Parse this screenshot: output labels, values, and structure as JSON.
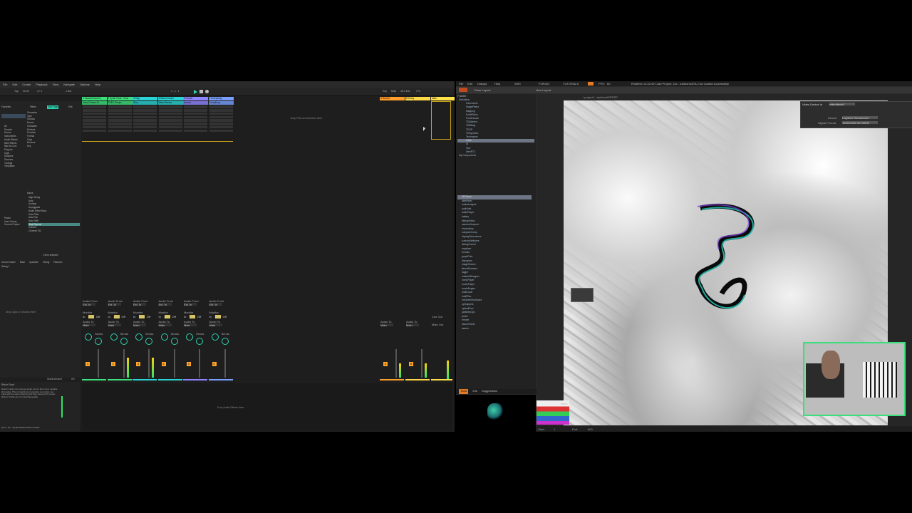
{
  "ableton": {
    "menu": [
      "File",
      "Edit",
      "Create",
      "Playback",
      "View",
      "Navigate",
      "Options",
      "Help"
    ],
    "toolbar": {
      "tap": "Tap",
      "tempo": "90.00",
      "sig": "4 / 4",
      "bar": "1 Bar",
      "position": "1 . 1 . 1",
      "key": "Key",
      "midi": "MIDI",
      "sample_rate": "48.0 kHz",
      "cpu": "0 %"
    },
    "browser": {
      "collections": [
        "Favorites"
      ],
      "categories": [
        "All",
        "Sounds",
        "Drums",
        "Instruments",
        "Audio Effects",
        "MIDI Effects",
        "Max for Live",
        "Plug-Ins",
        "Clips",
        "Samples",
        "Grooves",
        "Tunings",
        "Templates"
      ],
      "places": [
        "Packs",
        "User Library",
        "Current Project"
      ],
      "filters": [
        "Filters",
        "Auto Tags",
        "Edit"
      ],
      "filter_list": [
        "Character",
        "Type",
        "Sounds",
        "Drums",
        "Character",
        "Devices",
        "Function",
        "Format",
        "Clips",
        "Devices",
        "Key"
      ],
      "name_header": "Name",
      "items": [
        "Align Delay",
        "Amp",
        "Arcrope",
        "Arpeggiator",
        "Audio Effect Rack",
        "Auto Filter",
        "Auto Pan",
        "Auto Shift",
        "Beat Repeat",
        "Cabinet",
        "Channel EQ"
      ],
      "selected_item": "Beat Repeat",
      "status": "1 item selected",
      "groove_cols": [
        "Groove Name",
        "Base",
        "Quantize",
        "Timing",
        "Random"
      ],
      "groove_row": "Swing 1"
    },
    "tracks": [
      {
        "name": "1 Visual Chaos Dr",
        "color": "#3de07c",
        "clip": "Visual Chaos Dr"
      },
      {
        "name": "2 Synth Pads - Grav",
        "color": "#3de07c",
        "clip": "TDEV Tempo"
      },
      {
        "name": "3 Stop",
        "color": "#2ad4d4",
        "clip": "Stop"
      },
      {
        "name": "4 Warm Dream",
        "color": "#2ad4d4",
        "clip": "Warm Dream"
      },
      {
        "name": "5 Hornet",
        "color": "#8f86ff",
        "clip": "Hornet"
      },
      {
        "name": "6 Everything",
        "color": "#7aa0ff",
        "clip": "Everything"
      }
    ],
    "returns": [
      {
        "name": "A Reverb",
        "color": "#ff9e2c"
      },
      {
        "name": "B Delay",
        "color": "#ffd84a"
      },
      {
        "name": "Main",
        "color": "#ffe24a"
      }
    ],
    "drop_files": "Drop Files and Devices Here",
    "drop_clips": "Drop Clips or Devices Here",
    "drop_effects": "Drop Audio Effects Here",
    "io": {
      "audio_from": "Audio From",
      "ext_in": "Ext. In",
      "monitor": "Monitor",
      "in": "In",
      "auto": "Auto",
      "off": "Off",
      "audio_to": "Audio To",
      "main": "Main",
      "sends": "Sends",
      "cue_out": "Cue Out",
      "main_out": "Main Out"
    },
    "track_numbers": [
      "1",
      "2",
      "3",
      "4",
      "5",
      "6"
    ],
    "return_letters": [
      "A",
      "B"
    ],
    "info": {
      "title": "Return Track",
      "body": "Return tracks can process audio sent to them from multiple clip tracks. This is helpful for processing more than one track with the same effect(s) and thus saving CPU power. Return Tracks are not interchangeable.",
      "shortcut": "[Ctrl + Alt + R] Show/Hide Return Tracks"
    },
    "global_amount": "Global Amount",
    "global_percent": "0%"
  },
  "touchdesigner": {
    "menu": [
      "File",
      "Edit",
      "Dialogs",
      "Help"
    ],
    "top_tabs": [
      "WIKI",
      "FORUM",
      "TUTORIALS"
    ],
    "fps_label": "FPS:",
    "fps": "60",
    "status": "Realtime  13:22:49 Load Project: Joe - AbletonDATA 2.tox loaded successfully",
    "panes": {
      "layout_btn": "Pane Layout",
      "new_layout": "New Layout"
    },
    "path": "/ project1 / abletonAPPPPP",
    "palette_title": "Palette",
    "palette_tree": [
      "Derivative",
      "Generators",
      "ImageFilters",
      "Mapping",
      "PointFilters",
      "PointClouds",
      "TDAbleton",
      "TDBitwig",
      "TDVR",
      "TDSyncBox",
      "Techniques",
      "Tools",
      "UI",
      "Vive",
      "WebRTC",
      "My Components"
    ],
    "palette_selected": "Tools",
    "components": [
      "3DGizmo",
      "ableMeter",
      "audioAnalysis",
      "audioNet",
      "audioPlayer",
      "battery",
      "bitmapEditor",
      "cameraViewport",
      "chromaKey",
      "compareComp",
      "displayDimensions",
      "customAttributes",
      "debugControl",
      "equalizer",
      "formula",
      "graphPrint",
      "histogram",
      "imageSearch",
      "kinectRecorder",
      "logger",
      "materialDesigner",
      "menuPlayer",
      "moviePlayer",
      "movieEngine",
      "multiLocal",
      "multiPlex",
      "onScreenKeyboard",
      "opSnippets",
      "opticalFlow",
      "particlesGpu",
      "probe",
      "remote",
      "searchPanel",
      "search"
    ],
    "components_selected": "3DGizmo",
    "bottom_tabs": [
      "Tools",
      "Info",
      "Suggestions"
    ],
    "video_device": {
      "title": "Video Device In",
      "op": "videodevin1",
      "device_label": "Device",
      "device_value": "Logitech StreamCam",
      "format_label": "Signal Format",
      "format_value": "1920x1080 30.000Hz"
    },
    "timeline": {
      "start_label": "Start:",
      "start": "1",
      "end_label": "End:",
      "end": "600"
    },
    "node_label": "None"
  }
}
